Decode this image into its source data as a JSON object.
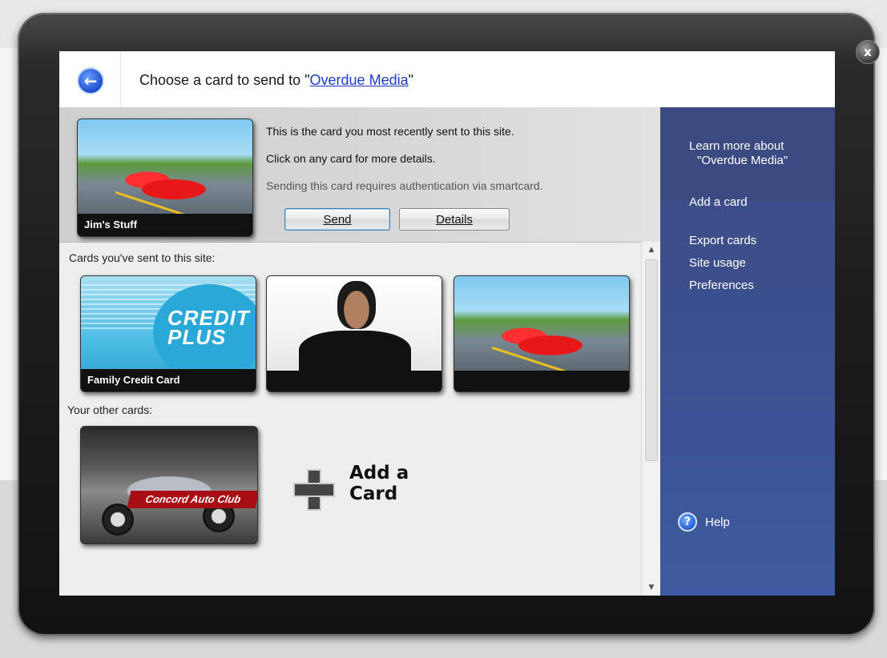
{
  "window": {
    "close_label": "x",
    "title_prefix": "Choose a card to send to \"",
    "title_site": "Overdue Media",
    "title_suffix": "\""
  },
  "recent": {
    "card_label": "Jim's Stuff",
    "line1": "This is the card you most recently sent to this site.",
    "line2": "Click on any card for more details.",
    "line3": "Sending this card requires authentication via smartcard.",
    "send_label": "Send",
    "details_label": "Details"
  },
  "sent_section": {
    "heading": "Cards you've sent to this site:",
    "cards": [
      {
        "label": "Family Credit Card",
        "logo_line1": "CREDIT",
        "logo_line2": "PLUS"
      },
      {
        "label": ""
      },
      {
        "label": ""
      }
    ]
  },
  "other_section": {
    "heading": "Your other cards:",
    "card_ribbon": "Concord Auto Club",
    "add_label_line1": "Add a",
    "add_label_line2": "Card"
  },
  "sidebar": {
    "learn_line1": "Learn more about",
    "learn_line2": "\"Overdue Media\"",
    "add_card": "Add a card",
    "export_cards": "Export cards",
    "site_usage": "Site usage",
    "preferences": "Preferences",
    "help": "Help"
  },
  "colors": {
    "sidebar": "#3a4f8e",
    "link": "#1a3cc8",
    "ribbon": "#a80c14"
  }
}
